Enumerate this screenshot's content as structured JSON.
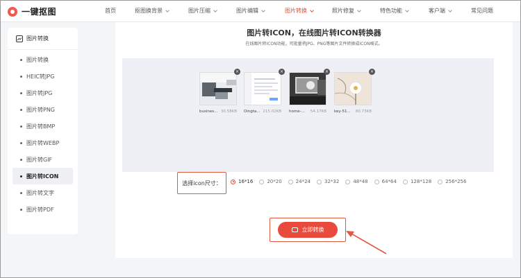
{
  "brand": {
    "name": "一键抠图"
  },
  "nav": {
    "items": [
      {
        "label": "首页",
        "dropdown": false,
        "active": false
      },
      {
        "label": "抠图换背景",
        "dropdown": true,
        "active": false
      },
      {
        "label": "图片压缩",
        "dropdown": true,
        "active": false
      },
      {
        "label": "图片编辑",
        "dropdown": true,
        "active": false
      },
      {
        "label": "图片转换",
        "dropdown": true,
        "active": true
      },
      {
        "label": "照片修复",
        "dropdown": true,
        "active": false
      },
      {
        "label": "特色功能",
        "dropdown": true,
        "active": false
      },
      {
        "label": "客户端",
        "dropdown": true,
        "active": false
      },
      {
        "label": "常见问题",
        "dropdown": false,
        "active": false
      }
    ]
  },
  "sidebar": {
    "header": "图片转换",
    "items": [
      {
        "label": "图片转换",
        "active": false
      },
      {
        "label": "HEIC转JPG",
        "active": false
      },
      {
        "label": "图片转JPG",
        "active": false
      },
      {
        "label": "图片转PNG",
        "active": false
      },
      {
        "label": "图片转BMP",
        "active": false
      },
      {
        "label": "图片转WEBP",
        "active": false
      },
      {
        "label": "图片转GIF",
        "active": false
      },
      {
        "label": "图片转ICON",
        "active": true
      },
      {
        "label": "图片转文字",
        "active": false
      },
      {
        "label": "图片转PDF",
        "active": false
      }
    ]
  },
  "main": {
    "title": "图片转ICON，在线图片转ICON转换器",
    "subtitle": "在线图片转ICON功能，可批量将JPG、PNG等图片文件转换成ICON格式。",
    "files": [
      {
        "name": "busines...",
        "size": "30.58KB"
      },
      {
        "name": "Dingta...",
        "size": "215.02KB"
      },
      {
        "name": "home-...",
        "size": "54.17KB"
      },
      {
        "name": "key-51...",
        "size": "80.73KB"
      }
    ],
    "size_label": "选择icon尺寸：",
    "sizes": [
      "16*16",
      "20*20",
      "24*24",
      "32*32",
      "48*48",
      "64*64",
      "128*128",
      "256*256"
    ],
    "selected_size": "16*16",
    "convert_label": "立即转换"
  },
  "icons": {
    "close": "×"
  },
  "colors": {
    "accent": "#e84a3c",
    "highlight_border": "#e0583f"
  }
}
